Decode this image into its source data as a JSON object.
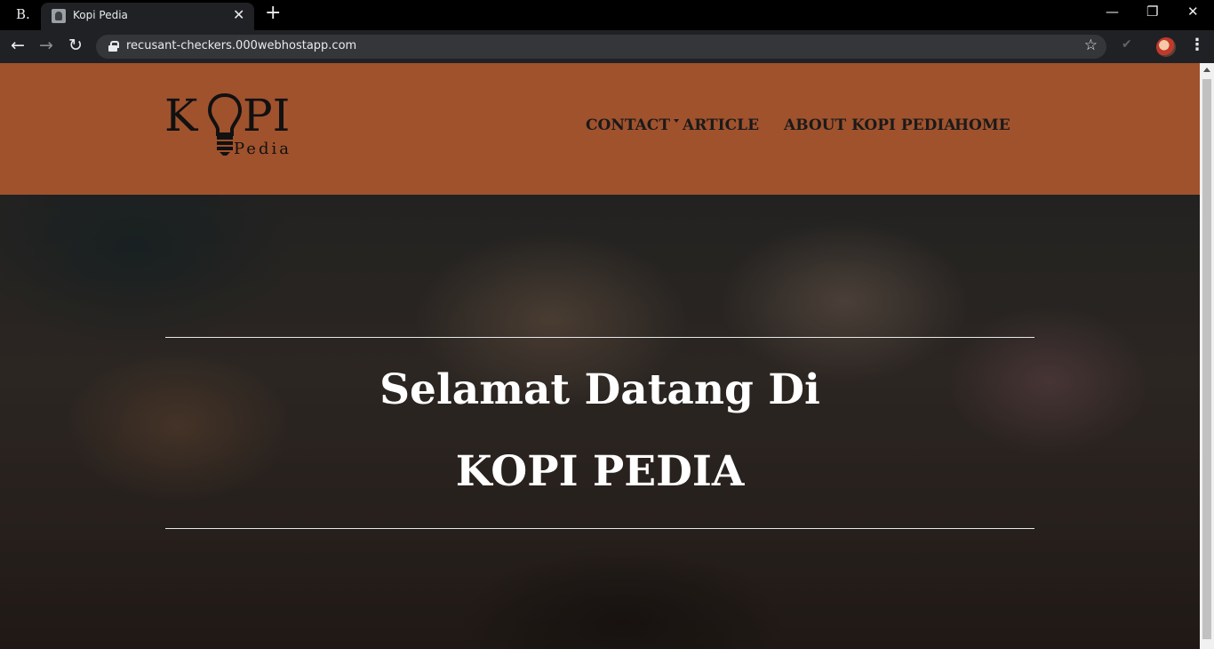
{
  "browser": {
    "tab_title": "Kopi Pedia",
    "url": "recusant-checkers.000webhostapp.com",
    "profile_letter": "B."
  },
  "site": {
    "logo_main": "KOPI",
    "logo_sub": "Pedia",
    "nav": {
      "contact": "CONTACT",
      "article": "ARTICLE",
      "about": "ABOUT KOPI PEDIA",
      "home": "HOME"
    },
    "hero": {
      "line1": "Selamat Datang Di",
      "line2": "KOPI PEDIA"
    },
    "header_color": "#a0522d"
  }
}
